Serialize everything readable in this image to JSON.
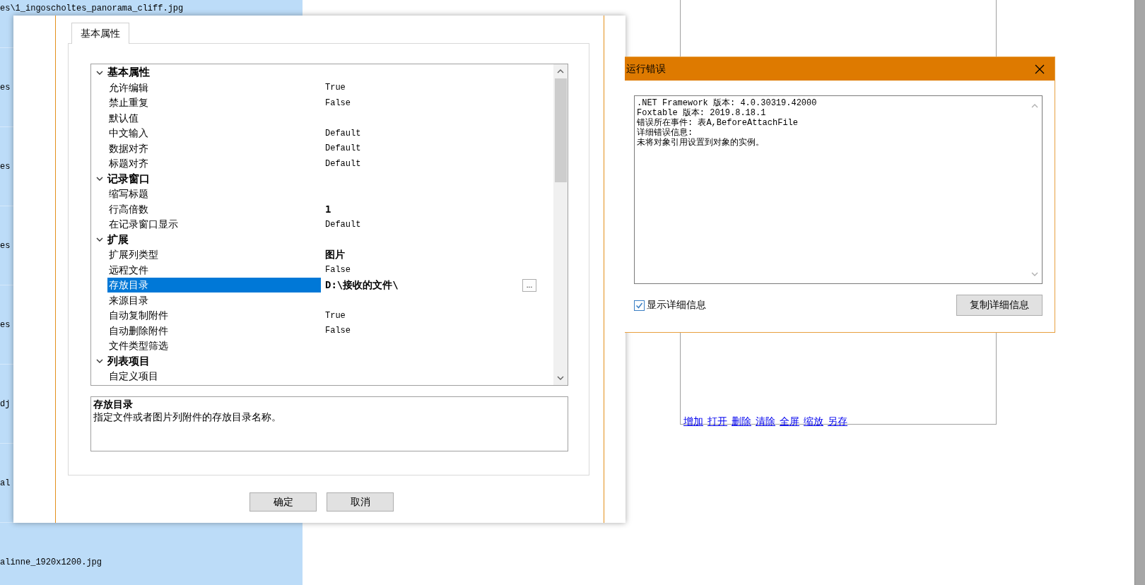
{
  "background_list": {
    "items": [
      "es\\1_ingoscholtes_panorama_cliff.jpg",
      "es",
      "es",
      "es",
      "es",
      "dj",
      "al",
      "alinne_1920x1200.jpg"
    ]
  },
  "back_window": {
    "links": [
      "增加",
      "打开",
      "删除",
      "清除",
      "全屏",
      "缩放",
      "另存"
    ]
  },
  "properties_dialog": {
    "tabs": [
      {
        "label": "基本属性",
        "selected": true
      }
    ],
    "grid": {
      "categories": [
        {
          "label": "基本属性",
          "expanded": true,
          "properties": [
            {
              "name": "允许编辑",
              "value": "True",
              "modified": false,
              "selected": false
            },
            {
              "name": "禁止重复",
              "value": "False",
              "modified": false,
              "selected": false
            },
            {
              "name": "默认值",
              "selected": false
            },
            {
              "name": "中文输入",
              "value": "Default",
              "modified": false,
              "selected": false
            },
            {
              "name": "数据对齐",
              "value": "Default",
              "modified": false,
              "selected": false
            },
            {
              "name": "标题对齐",
              "value": "Default",
              "modified": false,
              "selected": false
            }
          ]
        },
        {
          "label": "记录窗口",
          "expanded": true,
          "properties": [
            {
              "name": "缩写标题",
              "selected": false
            },
            {
              "name": "行高倍数",
              "value": "1",
              "modified": true,
              "selected": false
            },
            {
              "name": "在记录窗口显示",
              "value": "Default",
              "modified": false,
              "selected": false
            }
          ]
        },
        {
          "label": "扩展",
          "expanded": true,
          "properties": [
            {
              "name": "扩展列类型",
              "value": "图片",
              "modified": true,
              "selected": false
            },
            {
              "name": "远程文件",
              "value": "False",
              "modified": false,
              "selected": false
            },
            {
              "name": "存放目录",
              "value": "D:\\接收的文件\\",
              "modified": true,
              "selected": true,
              "button": "..."
            },
            {
              "name": "来源目录",
              "selected": false
            },
            {
              "name": "自动复制附件",
              "value": "True",
              "modified": false,
              "selected": false
            },
            {
              "name": "自动删除附件",
              "value": "False",
              "modified": false,
              "selected": false
            },
            {
              "name": "文件类型筛选",
              "selected": false
            }
          ]
        },
        {
          "label": "列表项目",
          "expanded": true,
          "properties": [
            {
              "name": "自定义项目",
              "selected": false
            }
          ]
        }
      ]
    },
    "description": {
      "title": "存放目录",
      "text": "指定文件或者图片列附件的存放目录名称。"
    },
    "buttons": [
      "确定",
      "取消"
    ]
  },
  "error_dialog": {
    "title": "运行错误",
    "details": [
      ".NET Framework 版本: 4.0.30319.42000",
      "Foxtable 版本: 2019.8.18.1",
      "错误所在事件: 表A,BeforeAttachFile",
      "详细错误信息:",
      "未将对象引用设置到对象的实例。"
    ],
    "show_details": {
      "label": "显示详细信息",
      "checked": true
    },
    "copy_button": "复制详细信息"
  }
}
